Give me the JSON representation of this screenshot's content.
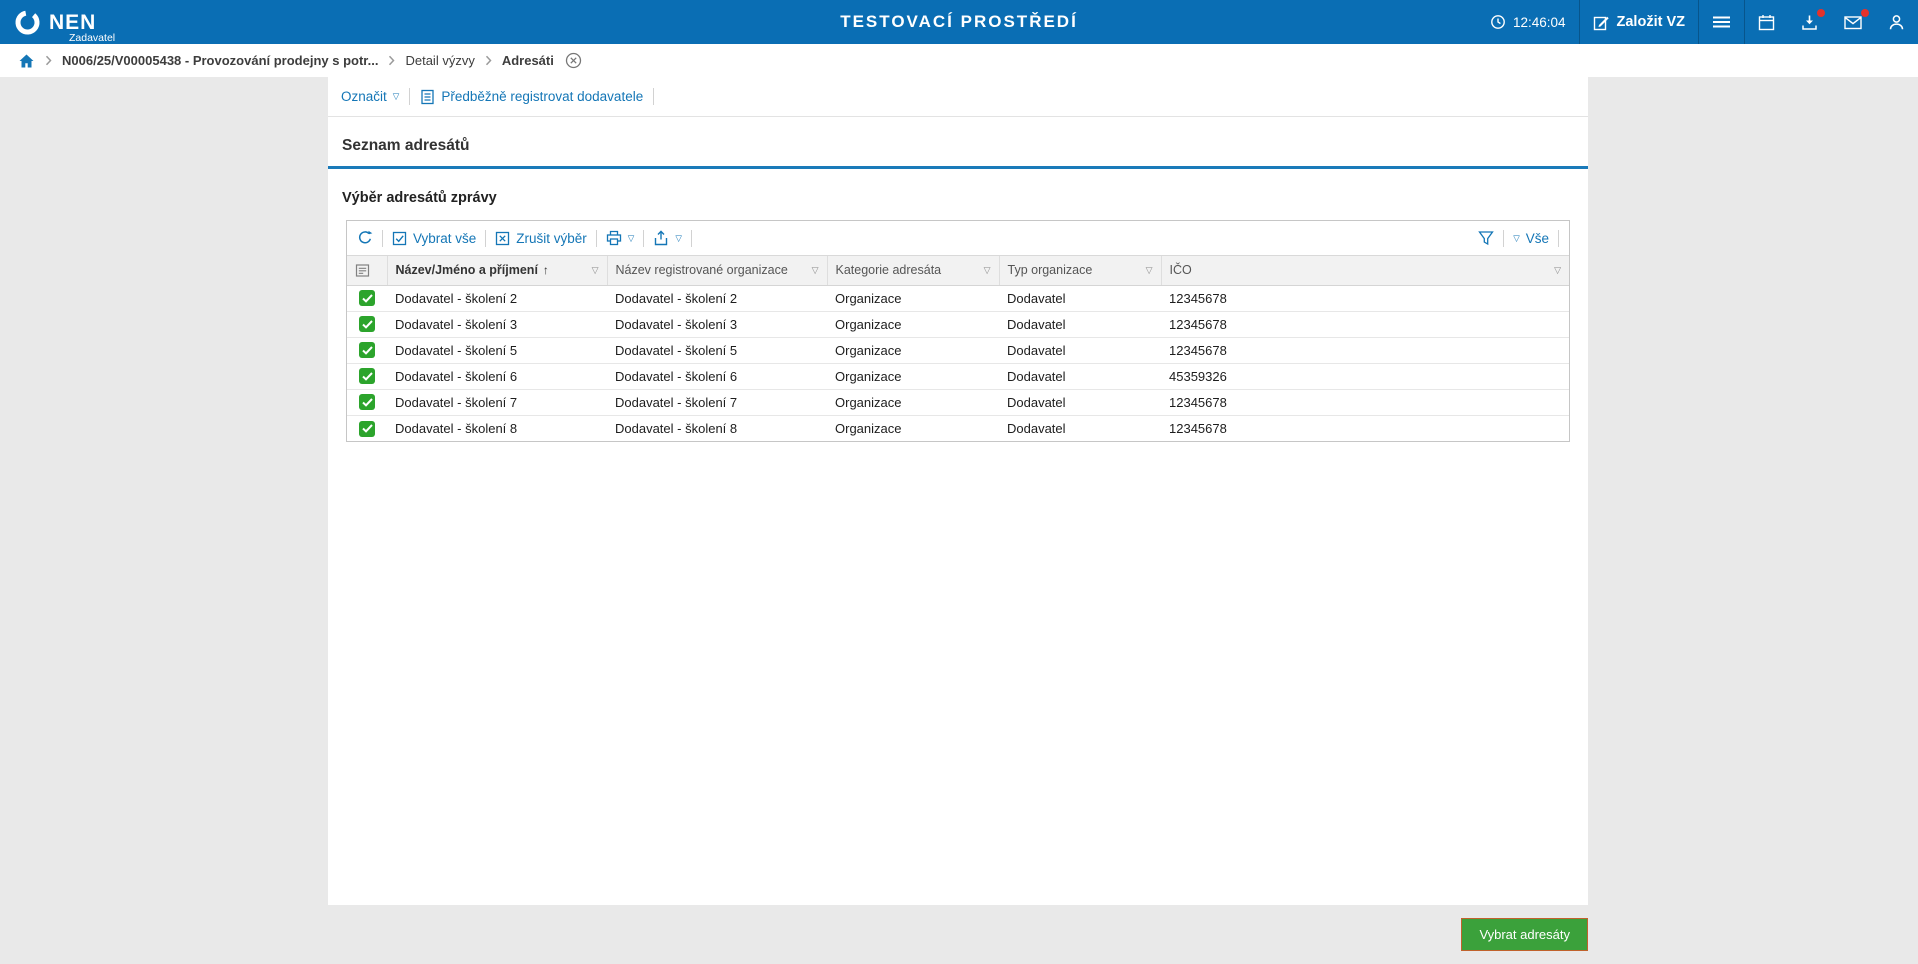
{
  "topbar": {
    "brand": "NEN",
    "brand_sub": "Zadavatel",
    "env_title": "TESTOVACÍ PROSTŘEDÍ",
    "time": "12:46:04",
    "create_label": "Založit VZ"
  },
  "breadcrumb": {
    "item1": "N006/25/V00005438 - Provozování prodejny s potr...",
    "item2": "Detail výzvy",
    "item3": "Adresáti"
  },
  "actionbar": {
    "mark": "Označit",
    "preregister": "Předběžně registrovat dodavatele"
  },
  "section": {
    "title": "Seznam adresátů",
    "subtitle": "Výběr adresátů zprávy"
  },
  "grid_toolbar": {
    "select_all": "Vybrat vše",
    "clear_selection": "Zrušit výběr",
    "all": "Vše"
  },
  "table": {
    "columns": {
      "name": "Název/Jméno a příjmení",
      "org": "Název registrované organizace",
      "category": "Kategorie adresáta",
      "type": "Typ organizace",
      "ico": "IČO"
    },
    "rows": [
      {
        "name": "Dodavatel - školení 2",
        "org": "Dodavatel - školení 2",
        "category": "Organizace",
        "type": "Dodavatel",
        "ico": "12345678"
      },
      {
        "name": "Dodavatel - školení 3",
        "org": "Dodavatel - školení 3",
        "category": "Organizace",
        "type": "Dodavatel",
        "ico": "12345678"
      },
      {
        "name": "Dodavatel - školení 5",
        "org": "Dodavatel - školení 5",
        "category": "Organizace",
        "type": "Dodavatel",
        "ico": "12345678"
      },
      {
        "name": "Dodavatel - školení 6",
        "org": "Dodavatel - školení 6",
        "category": "Organizace",
        "type": "Dodavatel",
        "ico": "45359326"
      },
      {
        "name": "Dodavatel - školení 7",
        "org": "Dodavatel - školení 7",
        "category": "Organizace",
        "type": "Dodavatel",
        "ico": "12345678"
      },
      {
        "name": "Dodavatel - školení 8",
        "org": "Dodavatel - školení 8",
        "category": "Organizace",
        "type": "Dodavatel",
        "ico": "12345678"
      }
    ]
  },
  "footer": {
    "select_button": "Vybrat adresáty"
  },
  "glyphs": {
    "caret_down": "▽",
    "sort_asc": "↑"
  },
  "colors": {
    "topbar_blue": "#0a6eb4",
    "accent_blue": "#1476b6",
    "checkbox_green": "#2ca42c",
    "button_green": "#3ba13b",
    "badge_red": "#e4322b"
  }
}
